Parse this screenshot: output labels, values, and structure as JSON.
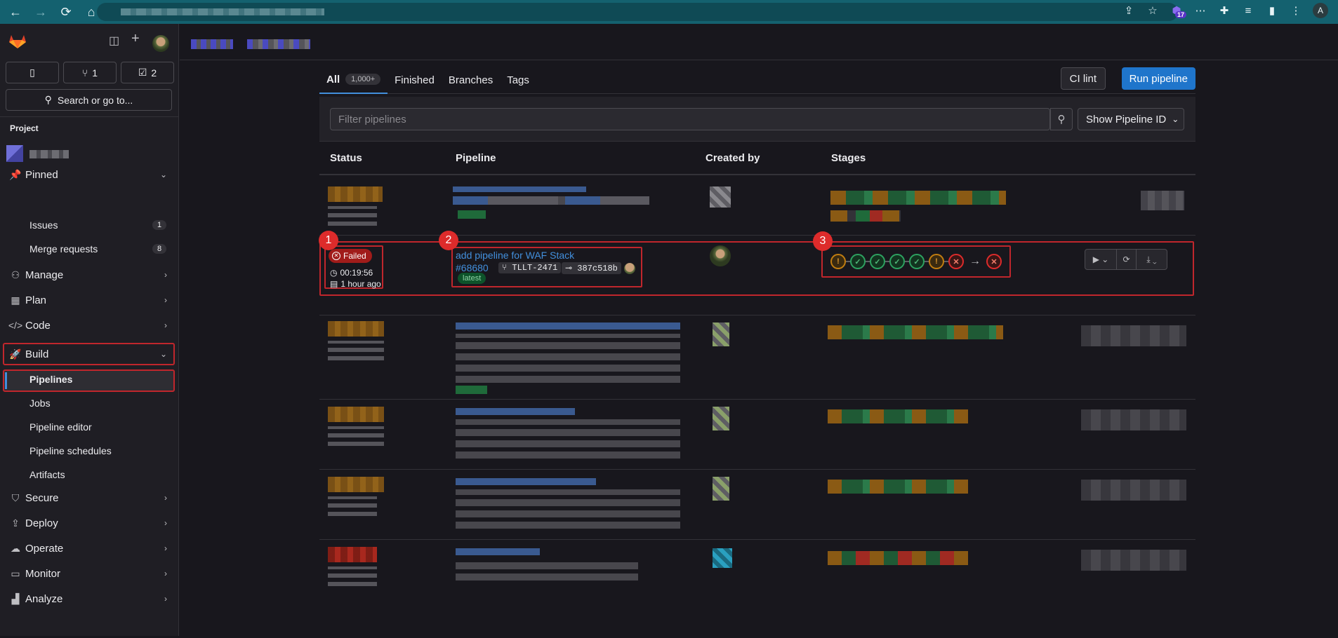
{
  "browser": {
    "back_icon": "←",
    "forward_icon": "→",
    "reload_icon": "⟳",
    "home_icon": "⌂",
    "extension_badge": "17",
    "account_initial": "A"
  },
  "sidebar": {
    "merge_requests_count": "1",
    "todos_count": "2",
    "search_label": "Search or go to...",
    "project_label": "Project",
    "pinned": "Pinned",
    "issues": {
      "label": "Issues",
      "count": "1"
    },
    "merge_requests": {
      "label": "Merge requests",
      "count": "8"
    },
    "manage": "Manage",
    "plan": "Plan",
    "code": "Code",
    "build": "Build",
    "build_items": [
      "Pipelines",
      "Jobs",
      "Pipeline editor",
      "Pipeline schedules",
      "Artifacts"
    ],
    "secure": "Secure",
    "deploy": "Deploy",
    "operate": "Operate",
    "monitor": "Monitor",
    "analyze": "Analyze"
  },
  "tabs": {
    "all": "All",
    "all_count": "1,000+",
    "finished": "Finished",
    "branches": "Branches",
    "tags": "Tags"
  },
  "buttons": {
    "ci_lint": "CI lint",
    "run_pipeline": "Run pipeline",
    "show_pipeline_id": "Show Pipeline ID"
  },
  "filter": {
    "placeholder": "Filter pipelines"
  },
  "table": {
    "headers": {
      "status": "Status",
      "pipeline": "Pipeline",
      "created_by": "Created by",
      "stages": "Stages"
    }
  },
  "focus_row": {
    "status": "Failed",
    "duration": "00:19:56",
    "finished": "1 hour ago",
    "title": "add pipeline for WAF Stack",
    "id": "#68680",
    "branch": "TLLT-2471",
    "commit": "387c518b",
    "tag": "latest",
    "stages": [
      "warning",
      "success",
      "success",
      "success",
      "success",
      "warning",
      "failed",
      "failed"
    ]
  },
  "annotations": [
    "1",
    "2",
    "3"
  ],
  "colors": {
    "accent": "#428fdc",
    "danger": "#dd2b2b",
    "success": "#2da160",
    "warning": "#c17d10"
  }
}
